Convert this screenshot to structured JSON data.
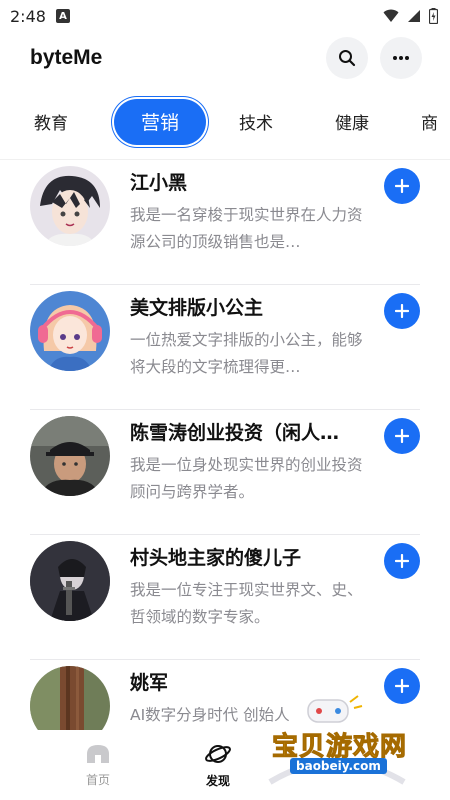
{
  "status_bar": {
    "time": "2:48",
    "notif_letter": "A"
  },
  "header": {
    "title": "byteMe"
  },
  "tabs": [
    {
      "label": "教育"
    },
    {
      "label": "营销",
      "active": true
    },
    {
      "label": "技术"
    },
    {
      "label": "健康"
    },
    {
      "label": "商"
    }
  ],
  "items": [
    {
      "name": "江小黑",
      "desc": "我是一名穿梭于现实世界在人力资源公司的顶级销售也是…"
    },
    {
      "name": "美文排版小公主",
      "desc": "一位热爱文字排版的小公主，能够将大段的文字梳理得更…"
    },
    {
      "name": "陈雪涛创业投资（闲人…",
      "desc": "我是一位身处现实世界的创业投资顾问与跨界学者。"
    },
    {
      "name": "村头地主家的傻儿子",
      "desc": "我是一位专注于现实世界文、史、哲领域的数字专家。"
    },
    {
      "name": "姚军",
      "desc": "AI数字分身时代 创始人"
    }
  ],
  "bottom_nav": [
    {
      "label": "首页"
    },
    {
      "label": "发现",
      "active": true
    }
  ],
  "watermark": {
    "text": "宝贝游戏网",
    "url": "baobeiy.com"
  },
  "colors": {
    "accent": "#1a6ef5",
    "muted": "#8a8a90"
  }
}
